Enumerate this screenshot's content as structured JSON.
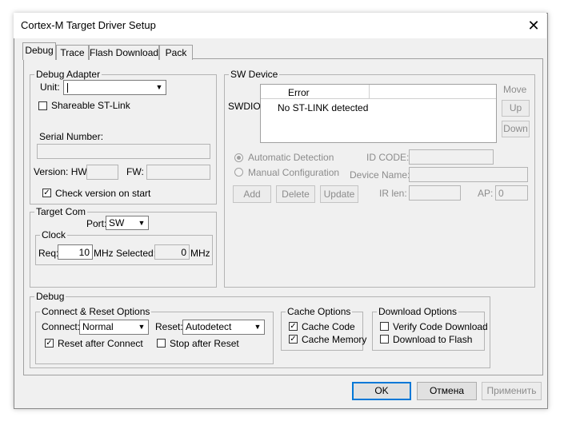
{
  "window": {
    "title": "Cortex-M Target Driver Setup",
    "close_glyph": "✕"
  },
  "tabs": [
    {
      "label": "Debug"
    },
    {
      "label": "Trace"
    },
    {
      "label": "Flash Download"
    },
    {
      "label": "Pack"
    }
  ],
  "debug_adapter": {
    "legend": "Debug Adapter",
    "unit_label": "Unit:",
    "unit_value": "",
    "shareable_label": "Shareable ST-Link",
    "serial_label": "Serial Number:",
    "serial_value": "",
    "version_label": "Version: HW:",
    "hw_value": "",
    "fw_label": "FW:",
    "fw_value": "",
    "check_version_label": "Check version on start"
  },
  "target_com": {
    "legend": "Target Com",
    "port_label": "Port:",
    "port_value": "SW",
    "clock_legend": "Clock",
    "req_label": "Req:",
    "req_value": "10",
    "req_unit": "MHz",
    "selected_label": "Selected:",
    "selected_value": "0",
    "selected_unit": "MHz"
  },
  "sw_device": {
    "legend": "SW Device",
    "swdio_label": "SWDIO",
    "table_headers": [
      "Error",
      ""
    ],
    "table_rows": [
      [
        "No ST-LINK detected",
        ""
      ]
    ],
    "move_label": "Move",
    "up_label": "Up",
    "down_label": "Down",
    "auto_detect_label": "Automatic Detection",
    "manual_config_label": "Manual Configuration",
    "idcode_label": "ID CODE:",
    "device_name_label": "Device Name:",
    "irlen_label": "IR len:",
    "ap_label": "AP:",
    "ap_value": "0",
    "add_label": "Add",
    "delete_label": "Delete",
    "update_label": "Update"
  },
  "debug": {
    "legend": "Debug",
    "connect_reset": {
      "legend": "Connect & Reset Options",
      "connect_label": "Connect:",
      "connect_value": "Normal",
      "reset_label": "Reset:",
      "reset_value": "Autodetect",
      "reset_after_connect_label": "Reset after Connect",
      "stop_after_reset_label": "Stop after Reset"
    },
    "cache": {
      "legend": "Cache Options",
      "cache_code_label": "Cache Code",
      "cache_memory_label": "Cache Memory"
    },
    "download": {
      "legend": "Download Options",
      "verify_label": "Verify Code Download",
      "download_flash_label": "Download to Flash"
    }
  },
  "footer": {
    "ok_label": "OK",
    "cancel_label": "Отмена",
    "apply_label": "Применить"
  },
  "colors": {
    "dialog_bg": "#f0f0f0",
    "accent": "#0078d7",
    "disabled_text": "#8c8c8c"
  },
  "icons": {
    "close": "close-icon",
    "dropdown": "chevron-down-icon",
    "check": "checkmark-icon"
  }
}
